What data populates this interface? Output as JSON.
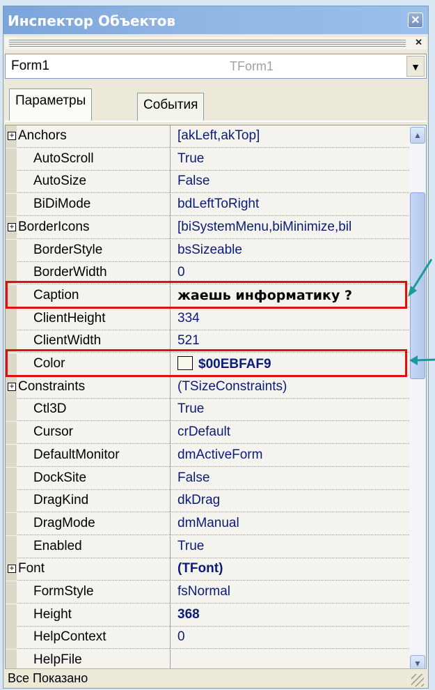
{
  "window": {
    "title": "Инспектор Объектов"
  },
  "selector": {
    "object_name": "Form1",
    "object_type": "TForm1"
  },
  "tabs": [
    {
      "label": "Параметры",
      "active": true
    },
    {
      "label": "События",
      "active": false
    }
  ],
  "properties": [
    {
      "name": "Anchors",
      "value": "[akLeft,akTop]",
      "expandable": true
    },
    {
      "name": "AutoScroll",
      "value": "True"
    },
    {
      "name": "AutoSize",
      "value": "False"
    },
    {
      "name": "BiDiMode",
      "value": "bdLeftToRight"
    },
    {
      "name": "BorderIcons",
      "value": "[biSystemMenu,biMinimize,bil",
      "expandable": true
    },
    {
      "name": "BorderStyle",
      "value": "bsSizeable"
    },
    {
      "name": "BorderWidth",
      "value": "0"
    },
    {
      "name": "Caption",
      "value": "жаешь информатику ?",
      "highlighted": true,
      "style": "black-bold"
    },
    {
      "name": "ClientHeight",
      "value": "334"
    },
    {
      "name": "ClientWidth",
      "value": "521"
    },
    {
      "name": "Color",
      "value": "$00EBFAF9",
      "highlighted": true,
      "style": "bold",
      "swatch": "#f9faeb"
    },
    {
      "name": "Constraints",
      "value": "(TSizeConstraints)",
      "expandable": true
    },
    {
      "name": "Ctl3D",
      "value": "True"
    },
    {
      "name": "Cursor",
      "value": "crDefault"
    },
    {
      "name": "DefaultMonitor",
      "value": "dmActiveForm"
    },
    {
      "name": "DockSite",
      "value": "False"
    },
    {
      "name": "DragKind",
      "value": "dkDrag"
    },
    {
      "name": "DragMode",
      "value": "dmManual"
    },
    {
      "name": "Enabled",
      "value": "True"
    },
    {
      "name": "Font",
      "value": "(TFont)",
      "expandable": true,
      "style": "bold"
    },
    {
      "name": "FormStyle",
      "value": "fsNormal"
    },
    {
      "name": "Height",
      "value": "368",
      "style": "bold"
    },
    {
      "name": "HelpContext",
      "value": "0"
    },
    {
      "name": "HelpFile",
      "value": ""
    }
  ],
  "status": {
    "text": "Все Показано"
  },
  "colors": {
    "highlight": "#e01010",
    "arrow": "#1a9a9a",
    "value_text": "#0a1b7a"
  }
}
